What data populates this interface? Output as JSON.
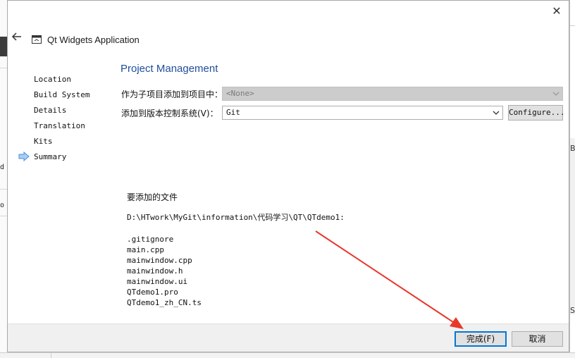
{
  "window": {
    "title": "Qt Widgets Application",
    "close_glyph": "✕"
  },
  "wizard": {
    "steps": [
      {
        "label": "Location"
      },
      {
        "label": "Build System"
      },
      {
        "label": "Details"
      },
      {
        "label": "Translation"
      },
      {
        "label": "Kits"
      },
      {
        "label": "Summary"
      }
    ],
    "current_step": "Summary",
    "current_step_icon": "arrow-right-icon"
  },
  "page": {
    "section_title": "Project Management",
    "add_as_subproject_label": "作为子项目添加到项目中：",
    "add_as_subproject_value": "<None>",
    "vcs_label": "添加到版本控制系统(V)：",
    "vcs_value": "Git",
    "configure_label": "Configure...",
    "files_heading": "要添加的文件",
    "files_path": "D:\\HTwork\\MyGit\\information\\代码学习\\QT\\QTdemo1:",
    "files": [
      ".gitignore",
      "main.cpp",
      "mainwindow.cpp",
      "mainwindow.h",
      "mainwindow.ui",
      "QTdemo1.pro",
      "QTdemo1_zh_CN.ts"
    ]
  },
  "footer": {
    "finish_label": "完成(F)",
    "cancel_label": "取消"
  },
  "background": {
    "left_fragments": [
      "d",
      "o"
    ],
    "right_fragments": [
      "Bl",
      "S"
    ]
  },
  "colors": {
    "accent": "#1f4e9c",
    "focus": "#0078d7",
    "annotation_arrow": "#e8382c",
    "step_arrow": "#4a90d9"
  }
}
